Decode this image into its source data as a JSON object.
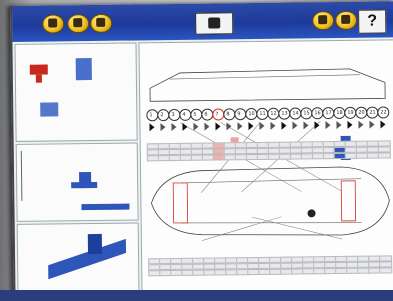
{
  "app": {
    "title": "",
    "help_label": "?"
  },
  "toolbar": {
    "buttons": [
      {
        "icon": "gear-icon"
      },
      {
        "icon": "car-icon"
      },
      {
        "icon": "measure-icon"
      },
      {
        "icon": "check-icon"
      },
      {
        "icon": "settings-icon"
      }
    ]
  },
  "diagram": {
    "column_numbers": [
      "1",
      "2",
      "3",
      "4",
      "5",
      "6",
      "7",
      "8",
      "9",
      "10",
      "11",
      "12",
      "13",
      "14",
      "15",
      "16",
      "17",
      "18",
      "19",
      "20",
      "21",
      "22"
    ],
    "highlight_color": "#d82c20",
    "accent_color": "#2e55b8"
  },
  "colors": {
    "toolbar": "#1d3a9a",
    "button": "#f0c020"
  }
}
